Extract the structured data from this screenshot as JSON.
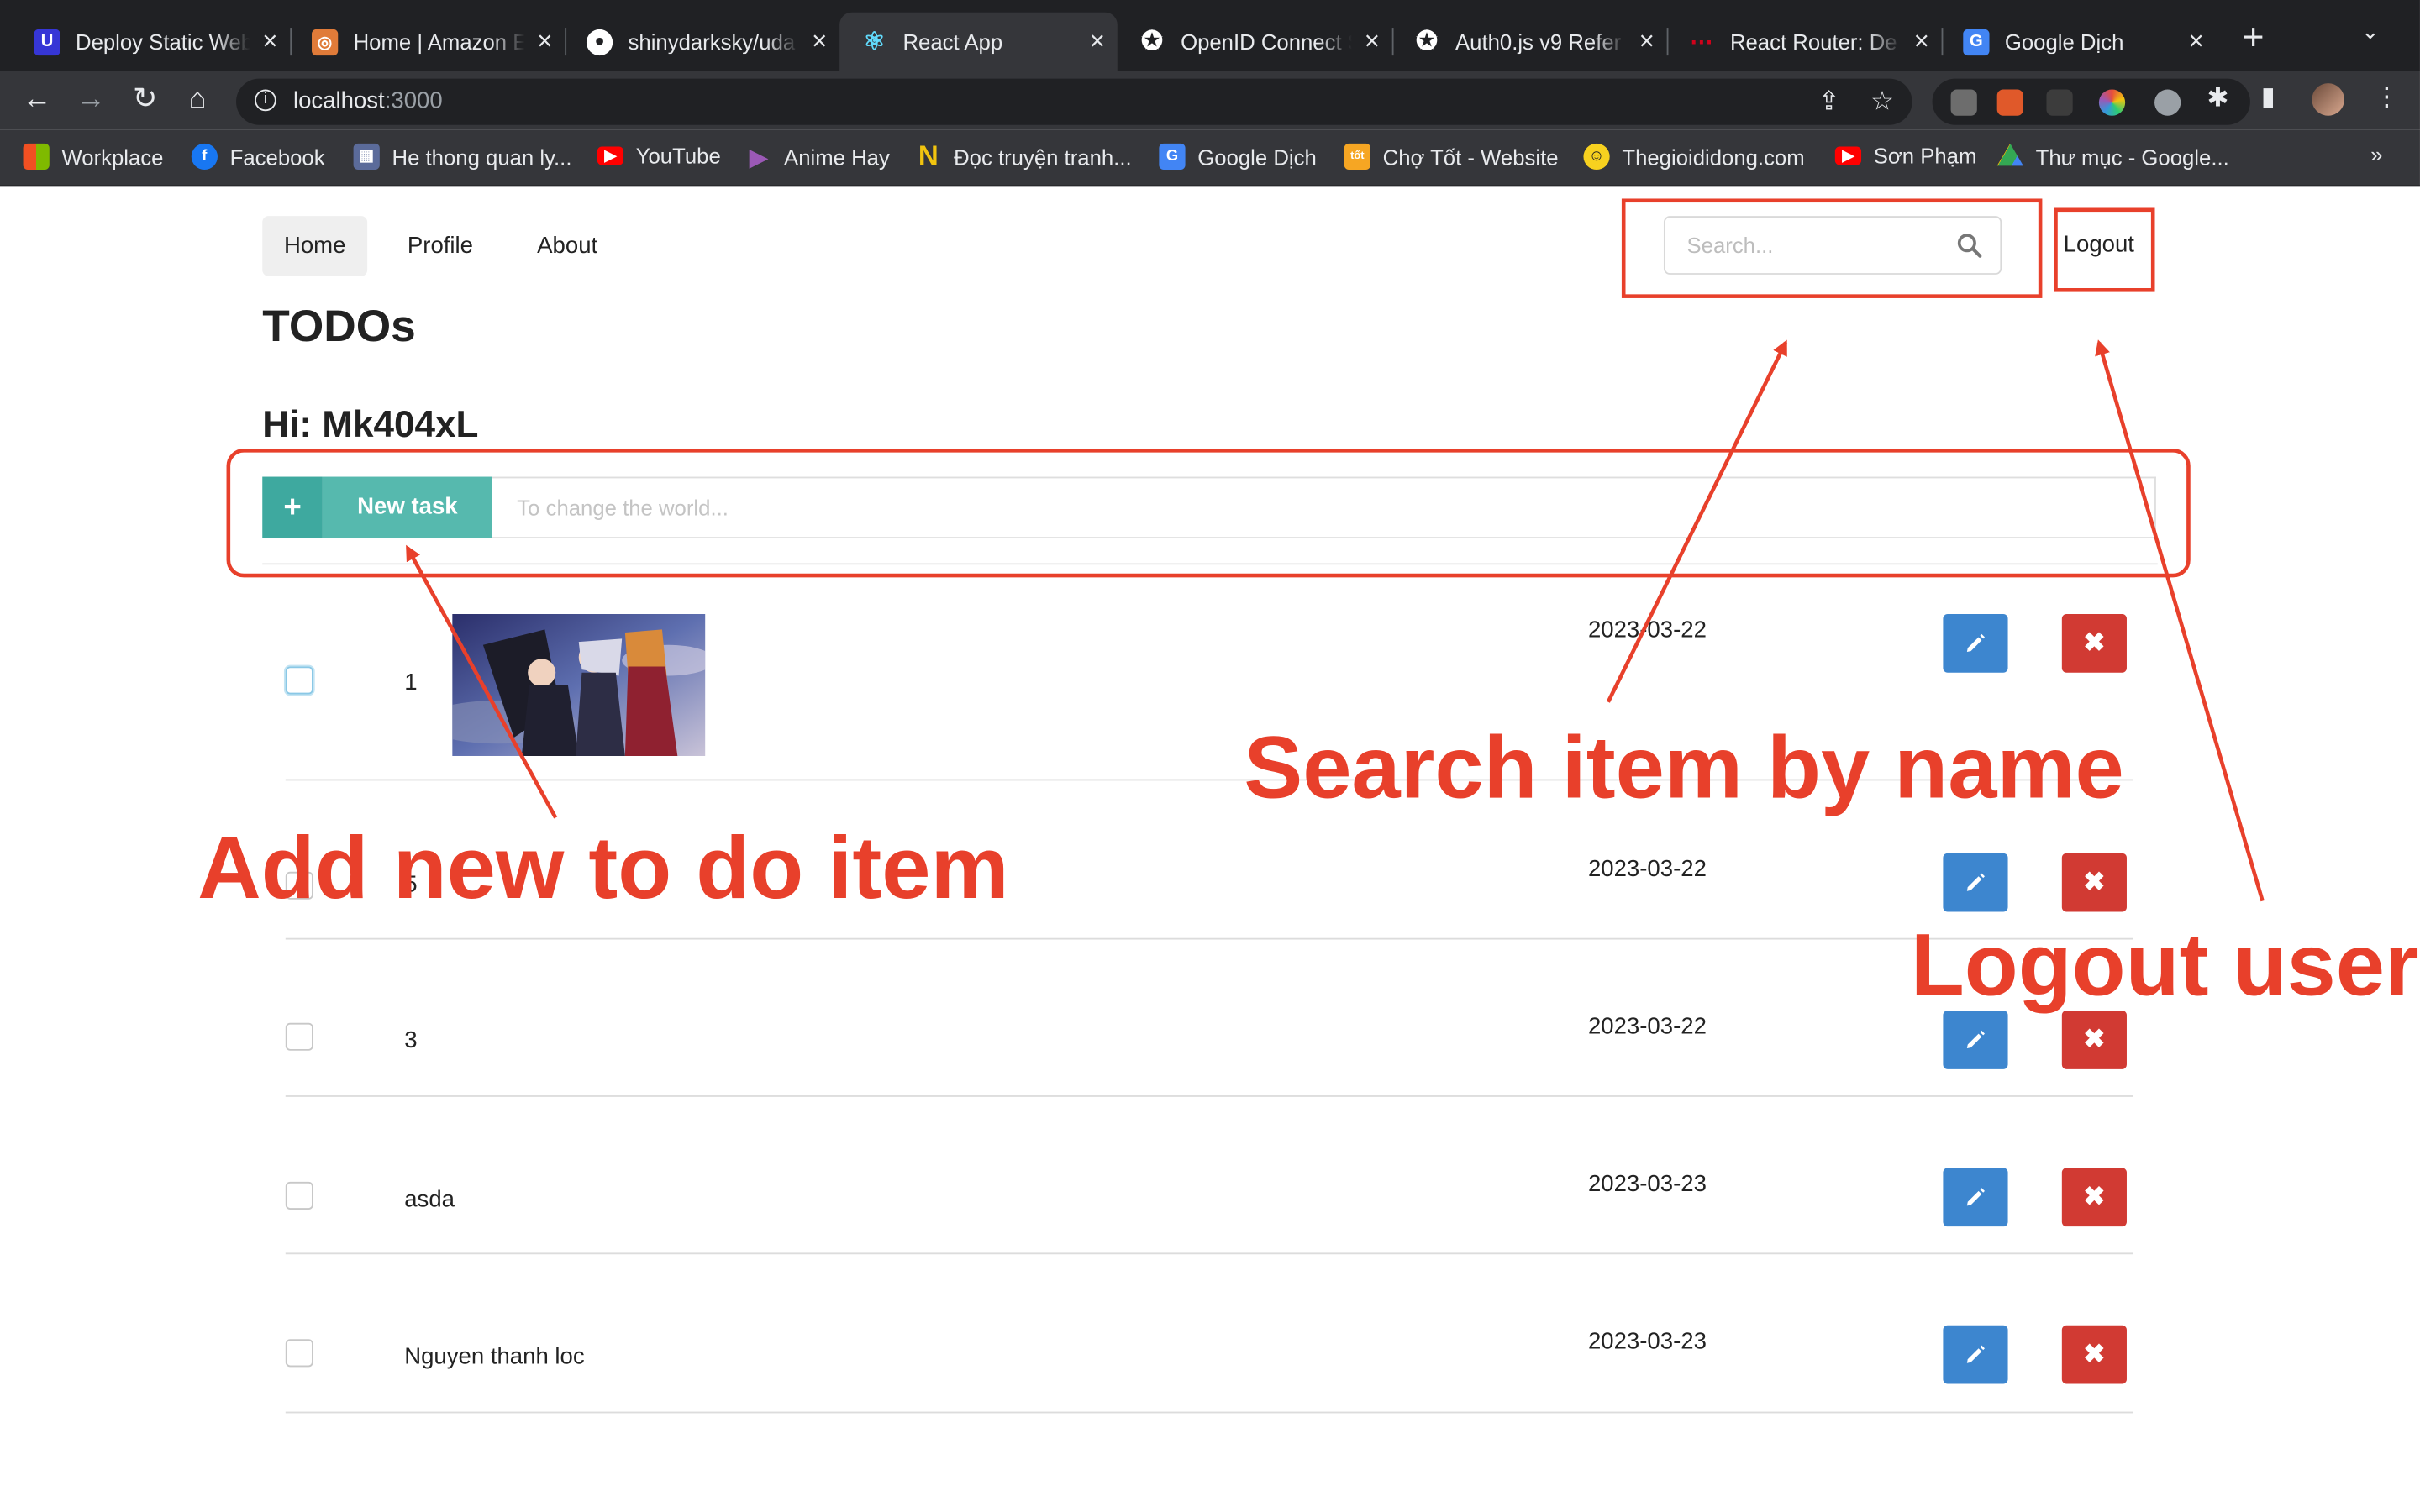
{
  "browser": {
    "tabs": [
      {
        "title": "Deploy Static Web",
        "icon": "udacity-icon",
        "color": "#5c5cf6",
        "active": false
      },
      {
        "title": "Home | Amazon E",
        "icon": "aws-icon",
        "color": "#e07b39",
        "active": false
      },
      {
        "title": "shinydarksky/uda",
        "icon": "github-icon",
        "color": "#ffffff",
        "active": false
      },
      {
        "title": "React App",
        "icon": "react-icon",
        "color": "#61dafb",
        "active": true
      },
      {
        "title": "OpenID Connect S",
        "icon": "auth0-icon",
        "color": "#ffffff",
        "active": false
      },
      {
        "title": "Auth0.js v9 Refer",
        "icon": "auth0-icon",
        "color": "#ffffff",
        "active": false
      },
      {
        "title": "React Router: De",
        "icon": "react-router-icon",
        "color": "#d0021b",
        "active": false
      },
      {
        "title": "Google Dịch",
        "icon": "google-translate-icon",
        "color": "#4285f4",
        "active": false
      }
    ],
    "address": {
      "host": "localhost",
      "port": ":3000"
    },
    "bookmarks": [
      {
        "label": "Workplace",
        "icon": "microsoft-icon",
        "color": "#f25022"
      },
      {
        "label": "Facebook",
        "icon": "facebook-icon",
        "color": "#1877f2"
      },
      {
        "label": "He thong quan ly...",
        "icon": "calendar-icon",
        "color": "#5b6b9a"
      },
      {
        "label": "YouTube",
        "icon": "youtube-icon",
        "color": "#ff0000"
      },
      {
        "label": "Anime Hay",
        "icon": "play-icon",
        "color": "#8e44ad"
      },
      {
        "label": "Đọc truyện tranh...",
        "icon": "n-icon",
        "color": "#f1c40f"
      },
      {
        "label": "Google Dịch",
        "icon": "google-translate-icon",
        "color": "#4285f4"
      },
      {
        "label": "Chợ Tốt - Website",
        "icon": "chotot-icon",
        "color": "#f6a623"
      },
      {
        "label": "Thegioididong.com",
        "icon": "tgdd-icon",
        "color": "#f7d11f"
      },
      {
        "label": "Sơn Phạm",
        "icon": "youtube-icon",
        "color": "#ff0000"
      },
      {
        "label": "Thư mục - Google...",
        "icon": "google-drive-icon",
        "color": "#34a853"
      }
    ],
    "bookmarks_more": "»"
  },
  "app": {
    "menu": {
      "home": "Home",
      "profile": "Profile",
      "about": "About"
    },
    "search_placeholder": "Search...",
    "logout": "Logout",
    "heading": "TODOs",
    "greeting": "Hi: Mk404xL",
    "new_task_label": "New task",
    "new_task_placeholder": "To change the world...",
    "todos": [
      {
        "name": "1",
        "date": "2023-03-22",
        "done": false,
        "has_image": true
      },
      {
        "name": "5",
        "date": "2023-03-22",
        "done": false,
        "has_image": false
      },
      {
        "name": "3",
        "date": "2023-03-22",
        "done": false,
        "has_image": false
      },
      {
        "name": "asda",
        "date": "2023-03-23",
        "done": false,
        "has_image": false
      },
      {
        "name": "Nguyen thanh loc",
        "date": "2023-03-23",
        "done": false,
        "has_image": false
      }
    ]
  },
  "annotations": {
    "add": "Add new to do item",
    "search": "Search item by name",
    "logout": "Logout user",
    "color": "#e8402b"
  }
}
